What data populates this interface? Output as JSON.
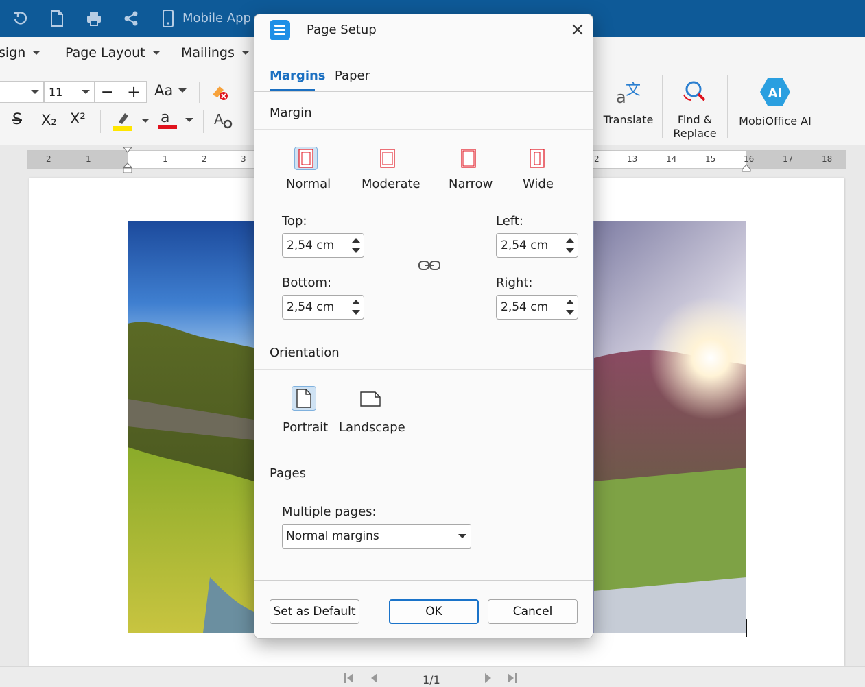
{
  "titlebar": {
    "quick_access": [
      "undo-icon",
      "new-document-icon",
      "print-icon",
      "share-icon",
      "mobile-icon"
    ],
    "mobile_app_label": "Mobile App"
  },
  "ribbon": {
    "tabs": [
      {
        "label": "sign"
      },
      {
        "label": "Page Layout"
      },
      {
        "label": "Mailings"
      }
    ],
    "font_size": "11",
    "case_label": "Aa",
    "subscript_label": "X₂",
    "superscript_label": "X²",
    "translate_label": "Translate",
    "find_replace_label": "Find &\nReplace",
    "mobioffice_ai_label": "MobiOffice AI",
    "ai_badge": "AI",
    "highlight_color": "#ffe600",
    "font_color": "#e0121d"
  },
  "ruler": {
    "numbers": [
      "2",
      "1",
      "1",
      "2",
      "3",
      "2",
      "13",
      "14",
      "15",
      "16",
      "17",
      "18"
    ]
  },
  "navigation": {
    "page_count": "1/1"
  },
  "dialog": {
    "title": "Page Setup",
    "tabs": [
      {
        "label": "Margins",
        "active": true
      },
      {
        "label": "Paper",
        "active": false
      }
    ],
    "margin_section": "Margin",
    "margin_presets": [
      {
        "label": "Normal",
        "selected": true
      },
      {
        "label": "Moderate",
        "selected": false
      },
      {
        "label": "Narrow",
        "selected": false
      },
      {
        "label": "Wide",
        "selected": false
      }
    ],
    "fields": {
      "top": {
        "label": "Top:",
        "value": "2,54 cm"
      },
      "bottom": {
        "label": "Bottom:",
        "value": "2,54 cm"
      },
      "left": {
        "label": "Left:",
        "value": "2,54 cm"
      },
      "right": {
        "label": "Right:",
        "value": "2,54 cm"
      }
    },
    "orientation_section": "Orientation",
    "orientations": [
      {
        "label": "Portrait",
        "selected": true
      },
      {
        "label": "Landscape",
        "selected": false
      }
    ],
    "pages_section": "Pages",
    "multiple_pages_label": "Multiple pages:",
    "multiple_pages_value": "Normal margins",
    "buttons": {
      "set_default": "Set as Default",
      "ok": "OK",
      "cancel": "Cancel"
    },
    "accent_color": "#1a6fc1"
  }
}
